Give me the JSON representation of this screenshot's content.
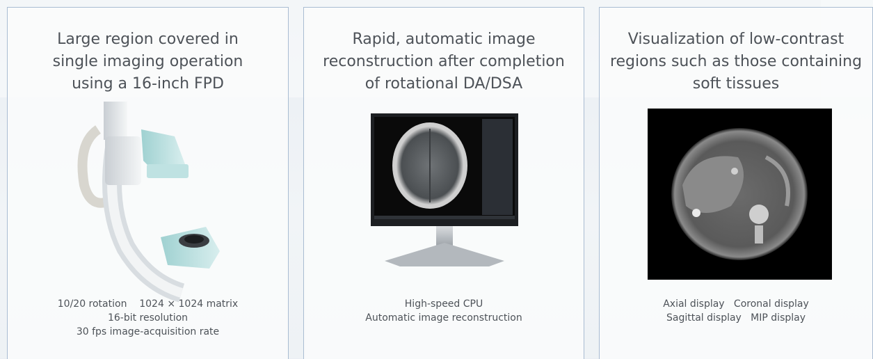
{
  "cards": [
    {
      "title": "Large region covered in\nsingle imaging operation\nusing a 16-inch FPD",
      "caption": [
        "10/20 rotation    1024 × 1024 matrix",
        "16-bit resolution",
        "30 fps image-acquisition rate"
      ],
      "image": "c-arm-fpd-system-image"
    },
    {
      "title": "Rapid, automatic image\nreconstruction after completion\nof rotational DA/DSA",
      "caption": [
        "High-speed CPU",
        "Automatic image reconstruction"
      ],
      "image": "monitor-brain-ct-image"
    },
    {
      "title": "Visualization of low-contrast\nregions such as those containing\nsoft tissues",
      "caption": [
        "Axial display   Coronal display",
        "Sagittal display   MIP display"
      ],
      "image": "abdominal-ct-scan-image"
    }
  ],
  "colors": {
    "card_border": "#a9bcd2",
    "text": "#4d5258",
    "background": "#eef2f5"
  }
}
